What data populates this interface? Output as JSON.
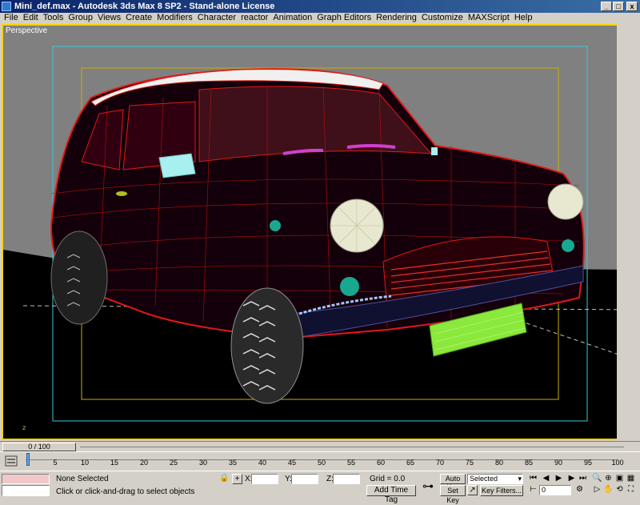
{
  "window": {
    "title": "Mini_def.max - Autodesk 3ds Max 8 SP2 - Stand-alone License",
    "minimize": "_",
    "maximize": "□",
    "close": "x"
  },
  "menu": [
    "File",
    "Edit",
    "Tools",
    "Group",
    "Views",
    "Create",
    "Modifiers",
    "Character",
    "reactor",
    "Animation",
    "Graph Editors",
    "Rendering",
    "Customize",
    "MAXScript",
    "Help"
  ],
  "viewport": {
    "label": "Perspective"
  },
  "timeline": {
    "frame_label": "0 / 100",
    "ticks": [
      "5",
      "10",
      "15",
      "20",
      "25",
      "30",
      "35",
      "40",
      "45",
      "50",
      "55",
      "60",
      "65",
      "70",
      "75",
      "80",
      "85",
      "90",
      "95",
      "100"
    ]
  },
  "status": {
    "selection": "None Selected",
    "prompt": "Click or click-and-drag to select objects",
    "x_label": "X:",
    "y_label": "Y:",
    "z_label": "Z:",
    "x_value": "",
    "y_value": "",
    "z_value": "",
    "grid": "Grid = 0.0",
    "add_time_tag": "Add Time Tag",
    "auto_key": "Auto Key",
    "set_key": "Set Key",
    "key_mode": "Selected",
    "key_filters": "Key Filters...",
    "frame_value": "0"
  },
  "colors": {
    "active_viewport_border": "#ffd200",
    "wireframe": "#ff2020",
    "headlight": "#e8e8d0",
    "license_plate": "#8be83c",
    "mirror": "#a8f0f0"
  }
}
